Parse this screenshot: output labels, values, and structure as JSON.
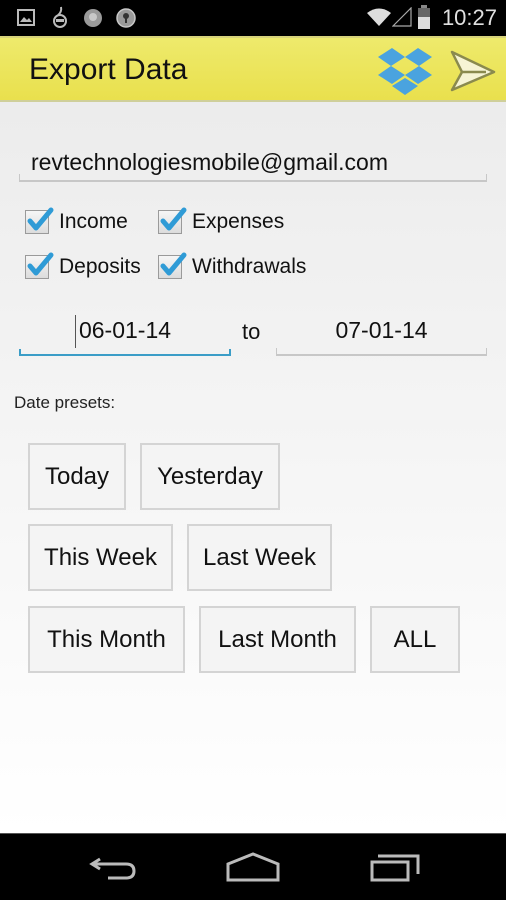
{
  "status_bar": {
    "time": "10:27",
    "notification_icons": [
      "gallery-icon",
      "android-debug-icon",
      "app-circle-icon",
      "keyhole-icon"
    ],
    "system_icons": [
      "wifi-icon",
      "cell-signal-icon",
      "battery-icon"
    ]
  },
  "action_bar": {
    "title": "Export Data",
    "actions": [
      {
        "name": "dropbox",
        "icon": "dropbox-icon"
      },
      {
        "name": "send",
        "icon": "send-icon"
      }
    ]
  },
  "form": {
    "email": {
      "value": "revtechnologiesmobile@gmail.com",
      "placeholder": ""
    },
    "checkboxes": [
      {
        "label": "Income",
        "checked": true
      },
      {
        "label": "Expenses",
        "checked": true
      },
      {
        "label": "Deposits",
        "checked": true
      },
      {
        "label": "Withdrawals",
        "checked": true
      }
    ],
    "date_from": "06-01-14",
    "to_label": "to",
    "date_to": "07-01-14",
    "presets_label": "Date presets:",
    "presets": [
      "Today",
      "Yesterday",
      "This Week",
      "Last Week",
      "This Month",
      "Last Month",
      "ALL"
    ]
  },
  "colors": {
    "action_bar": "#ece660",
    "accent": "#3b9dc7",
    "dropbox": "#4aa3df",
    "check": "#2f9bd6"
  },
  "nav_bar": {
    "buttons": [
      "back",
      "home",
      "recents"
    ]
  }
}
